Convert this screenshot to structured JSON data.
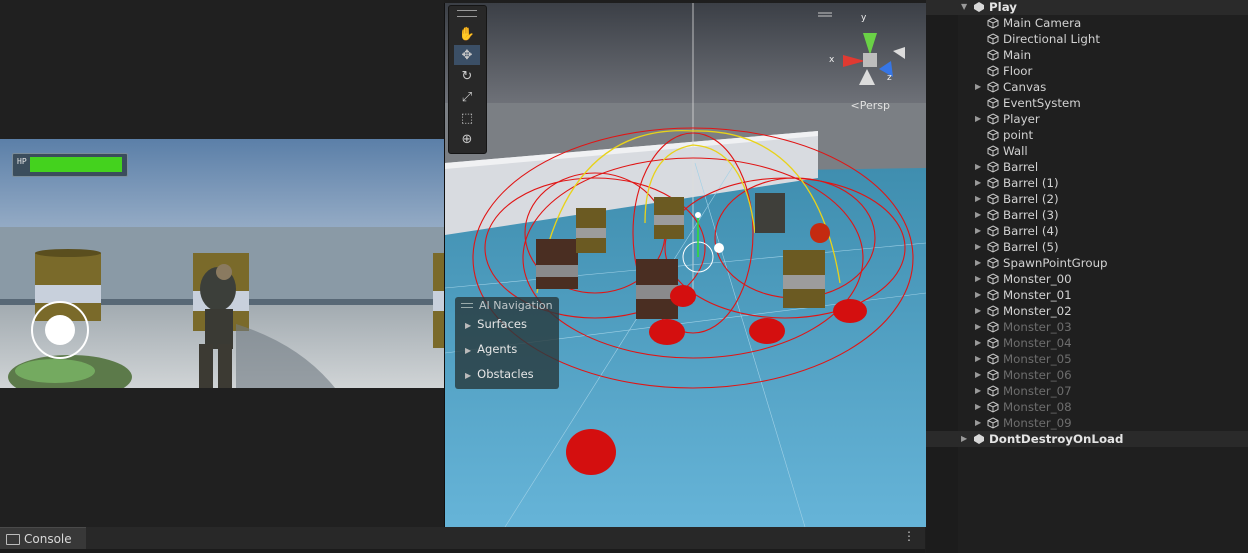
{
  "game": {
    "hp_label": "HP",
    "hp_value": 1.0,
    "hp_color": "#44d21e"
  },
  "scene": {
    "persp_label": "Persp",
    "axis_x": "x",
    "axis_y": "y",
    "axis_z": "z",
    "ai_navigation": {
      "title": "AI Navigation",
      "items": [
        {
          "label": "Surfaces"
        },
        {
          "label": "Agents"
        },
        {
          "label": "Obstacles"
        }
      ]
    },
    "tools": [
      {
        "name": "hand-tool",
        "icon": "hand-icon"
      },
      {
        "name": "move-tool",
        "icon": "move-icon",
        "active": true
      },
      {
        "name": "rotate-tool",
        "icon": "rotate-icon"
      },
      {
        "name": "scale-tool",
        "icon": "scale-icon"
      },
      {
        "name": "rect-tool",
        "icon": "rect-icon"
      },
      {
        "name": "transform-tool",
        "icon": "transform-icon"
      }
    ]
  },
  "hierarchy": {
    "scene_name": "Play",
    "items": [
      {
        "label": "Main Camera",
        "expandable": false,
        "dim": false
      },
      {
        "label": "Directional Light",
        "expandable": false,
        "dim": false
      },
      {
        "label": "Main",
        "expandable": false,
        "dim": false
      },
      {
        "label": "Floor",
        "expandable": false,
        "dim": false
      },
      {
        "label": "Canvas",
        "expandable": true,
        "dim": false
      },
      {
        "label": "EventSystem",
        "expandable": false,
        "dim": false
      },
      {
        "label": "Player",
        "expandable": true,
        "dim": false
      },
      {
        "label": "point",
        "expandable": false,
        "dim": false
      },
      {
        "label": "Wall",
        "expandable": false,
        "dim": false
      },
      {
        "label": "Barrel",
        "expandable": true,
        "dim": false
      },
      {
        "label": "Barrel (1)",
        "expandable": true,
        "dim": false
      },
      {
        "label": "Barrel (2)",
        "expandable": true,
        "dim": false
      },
      {
        "label": "Barrel (3)",
        "expandable": true,
        "dim": false
      },
      {
        "label": "Barrel (4)",
        "expandable": true,
        "dim": false
      },
      {
        "label": "Barrel (5)",
        "expandable": true,
        "dim": false
      },
      {
        "label": "SpawnPointGroup",
        "expandable": true,
        "dim": false
      },
      {
        "label": "Monster_00",
        "expandable": true,
        "dim": false
      },
      {
        "label": "Monster_01",
        "expandable": true,
        "dim": false
      },
      {
        "label": "Monster_02",
        "expandable": true,
        "dim": false
      },
      {
        "label": "Monster_03",
        "expandable": true,
        "dim": true
      },
      {
        "label": "Monster_04",
        "expandable": true,
        "dim": true
      },
      {
        "label": "Monster_05",
        "expandable": true,
        "dim": true
      },
      {
        "label": "Monster_06",
        "expandable": true,
        "dim": true
      },
      {
        "label": "Monster_07",
        "expandable": true,
        "dim": true
      },
      {
        "label": "Monster_08",
        "expandable": true,
        "dim": true
      },
      {
        "label": "Monster_09",
        "expandable": true,
        "dim": true
      }
    ],
    "dont_destroy_label": "DontDestroyOnLoad"
  },
  "console": {
    "tab_label": "Console",
    "menu_icon": "kebab-menu-icon"
  },
  "colors": {
    "editor_bg": "#1e1e1e",
    "active_tool": "#3b4f66",
    "gizmo_red": "#e01515",
    "gizmo_yellow": "#e8d21a"
  }
}
